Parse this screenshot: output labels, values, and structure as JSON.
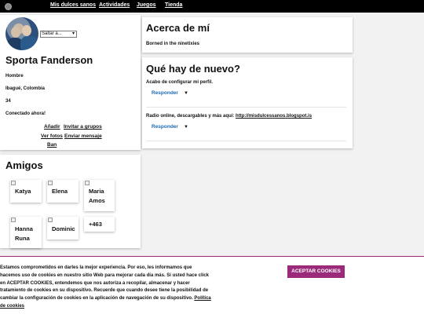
{
  "nav": {
    "items": [
      "Mis dulces sanos",
      "Actividades",
      "Juegos",
      "Tienda"
    ]
  },
  "profile": {
    "jump_select": "Saltar a...",
    "name": "Sporta Fanderson",
    "gender": "Hombre",
    "location": "Ibagué, Colombia",
    "age": "34",
    "status": "Conectado ahora!",
    "links": {
      "add": "Añadir",
      "invite": "Invitar a grupos",
      "photos": "Ver fotos",
      "message": "Enviar mensaje",
      "ban": "Ban"
    }
  },
  "friends": {
    "title": "Amigos",
    "items": [
      {
        "name": "Katya"
      },
      {
        "name": "Elena"
      },
      {
        "name": "Maria Amos"
      },
      {
        "name": "Hanna Runa"
      },
      {
        "name": "Dominic"
      }
    ],
    "more": "+463"
  },
  "about": {
    "title": "Acerca de mí",
    "text": "Borned in the ninetixies"
  },
  "news": {
    "title": "Qué hay de nuevo?",
    "posts": [
      {
        "text": "Acabo de configurar mi perfil.",
        "link": "",
        "reply": "Responder",
        "caret": "▼"
      },
      {
        "text": "Radio online, descargables y más aquí: ",
        "link": "http://misdulcessanos.blogspot.is",
        "reply": "Responder",
        "caret": "▼"
      }
    ]
  },
  "cookie": {
    "text": "Estamos comprometidos en darles la mejor experiencia. Por eso, les informamos que hacemos uso de cookies en nuestro sitio Web para mejorar cada día más. Si usted hace click en ACEPTAR COOKIES, entendemos que nos autoriza a recopilar, almacenar y hacer tratamiento de cookies en su dispositivo. Recuerde que cuando desee tiene la posibilidad de cambiar la configuración de cookies en la aplicación de navegación de su dispositivo.",
    "policy_link": "Política de cookies",
    "accept": "ACEPTAR COOKIES"
  },
  "colors": {
    "accent": "#9b2b7a",
    "link_blue": "#1c6ab3",
    "topbar": "#000000"
  }
}
